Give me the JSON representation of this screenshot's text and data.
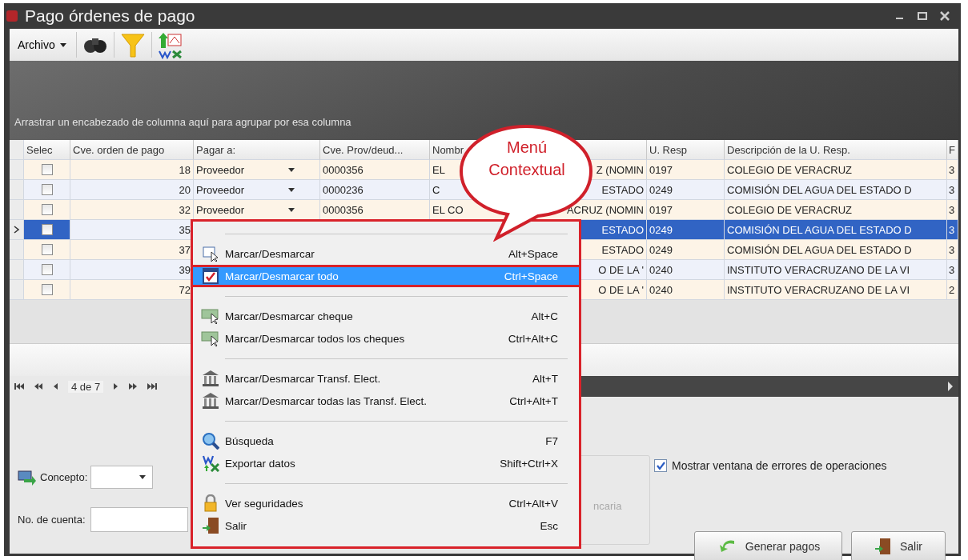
{
  "window": {
    "title": "Pago órdenes de pago"
  },
  "toolbar": {
    "menu_label": "Archivo"
  },
  "group_panel": {
    "hint": "Arrastrar un encabezado de columna aquí para agrupar por esa columna"
  },
  "table": {
    "columns": [
      "Selec",
      "Cve. orden de pago",
      "Pagar a:",
      "Cve. Prov/deud...",
      "Nombr",
      "U. Resp",
      "Descripción de la U. Resp.",
      "F"
    ],
    "rows": [
      {
        "selected": false,
        "checked": false,
        "clave": "18",
        "pagar_a": "Proveedor",
        "prov": "0000356",
        "nombre_left": "EL",
        "nombre_right": "Z (NOMIN",
        "u_resp": "0197",
        "descripcion": "COLEGIO DE VERACRUZ",
        "column_8": "3"
      },
      {
        "selected": false,
        "checked": false,
        "clave": "20",
        "pagar_a": "Proveedor",
        "prov": "0000236",
        "nombre_left": "C",
        "nombre_right": "ESTADO",
        "u_resp": "0249",
        "descripcion": "COMISIÓN DEL AGUA DEL ESTADO D",
        "column_8": "3"
      },
      {
        "selected": false,
        "checked": false,
        "clave": "32",
        "pagar_a": "Proveedor",
        "prov": "0000356",
        "nombre_left": "EL CO",
        "nombre_right": "ACRUZ (NOMIN",
        "u_resp": "0197",
        "descripcion": "COLEGIO DE VERACRUZ",
        "column_8": "3"
      },
      {
        "selected": true,
        "checked": false,
        "clave": "35",
        "nombre_right": "ESTADO",
        "u_resp": "0249",
        "descripcion": "COMISIÓN DEL AGUA DEL ESTADO D",
        "column_8": "3"
      },
      {
        "selected": false,
        "checked": false,
        "clave": "37",
        "nombre_right": "ESTADO",
        "u_resp": "0249",
        "descripcion": "COMISIÓN DEL AGUA DEL ESTADO D",
        "column_8": "3"
      },
      {
        "selected": false,
        "checked": false,
        "clave": "39",
        "nombre_right": "O DE LA '",
        "u_resp": "0240",
        "descripcion": "INSTITUTO VERACRUZANO DE LA VI",
        "column_8": "3"
      },
      {
        "selected": false,
        "checked": false,
        "clave": "72",
        "nombre_right": "O DE LA '",
        "u_resp": "0240",
        "descripcion": "INSTITUTO VERACRUZANO DE LA VI",
        "column_8": "2"
      }
    ]
  },
  "pager": {
    "position": "4 de 7"
  },
  "form": {
    "concepto_label": "Concepto:",
    "cuenta_label": "No. de cuenta:",
    "group_text": "ncaria",
    "group_disabled": true,
    "errors_checkbox": {
      "label": "Mostrar ventana de errores de operaciones",
      "checked": true
    },
    "buttons": [
      "Generar pagos",
      "Salir"
    ]
  },
  "context_menu": {
    "items": [
      {
        "kind": "separator"
      },
      {
        "kind": "item",
        "label": "Marcar/Desmarcar",
        "shortcut": "Alt+Space",
        "selected": false,
        "annotated": false
      },
      {
        "kind": "item",
        "label": "Marcar/Desmarcar todo",
        "shortcut": "Ctrl+Space",
        "selected": true,
        "annotated": true
      },
      {
        "kind": "separator"
      },
      {
        "kind": "item",
        "label": "Marcar/Desmarcar cheque",
        "shortcut": "Alt+C",
        "selected": false,
        "annotated": false
      },
      {
        "kind": "item",
        "label": "Marcar/Desmarcar todos los cheques",
        "shortcut": "Ctrl+Alt+C",
        "selected": false,
        "annotated": false
      },
      {
        "kind": "separator"
      },
      {
        "kind": "item",
        "label": "Marcar/Desmarcar Transf. Elect.",
        "shortcut": "Alt+T",
        "selected": false,
        "annotated": false
      },
      {
        "kind": "item",
        "label": "Marcar/Desmarcar todas las Transf. Elect.",
        "shortcut": "Ctrl+Alt+T",
        "selected": false,
        "annotated": false
      },
      {
        "kind": "separator"
      },
      {
        "kind": "item",
        "label": "Búsqueda",
        "shortcut": "F7",
        "selected": false,
        "annotated": false
      },
      {
        "kind": "item",
        "label": "Exportar datos",
        "shortcut": "Shift+Ctrl+X",
        "selected": false,
        "annotated": false
      },
      {
        "kind": "separator"
      },
      {
        "kind": "item",
        "label": "Ver seguridades",
        "shortcut": "Ctrl+Alt+V",
        "selected": false,
        "annotated": false
      },
      {
        "kind": "item",
        "label": "Salir",
        "shortcut": "Esc",
        "selected": false,
        "annotated": false
      }
    ]
  },
  "callout": {
    "text": "Menú Contextual"
  }
}
